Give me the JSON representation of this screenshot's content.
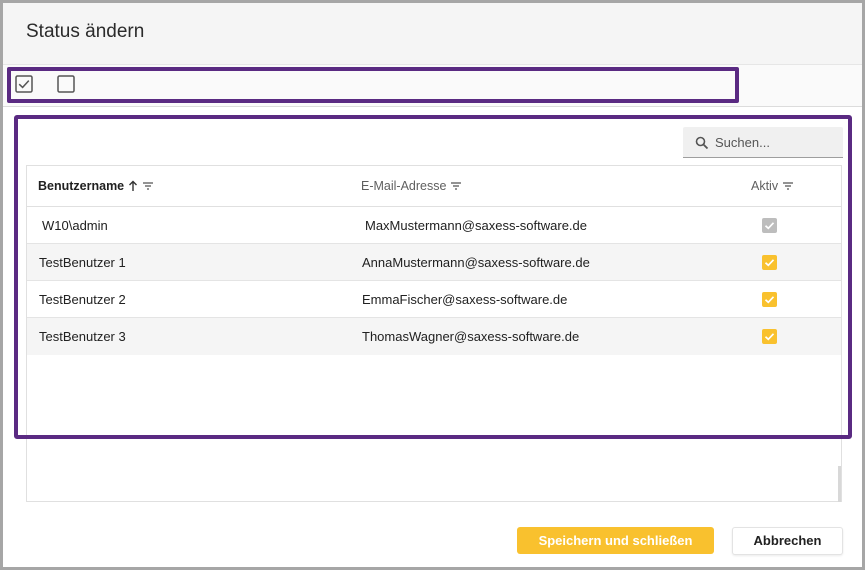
{
  "dialog": {
    "title": "Status ändern"
  },
  "toolbar": {
    "activate_icon": "checked-box-icon",
    "deactivate_icon": "empty-box-icon"
  },
  "search": {
    "placeholder": "Suchen..."
  },
  "grid": {
    "columns": [
      {
        "label": "Benutzername",
        "sort": "ascending",
        "filter_icon": "filter-icon"
      },
      {
        "label": "E-Mail-Adresse",
        "filter_icon": "filter-icon"
      },
      {
        "label": "Aktiv",
        "filter_icon": "filter-icon"
      }
    ],
    "rows": [
      {
        "username": "W10\\admin",
        "email": "MaxMustermann@saxess-software.de",
        "active": true,
        "disabled": true
      },
      {
        "username": "TestBenutzer 1",
        "email": "AnnaMustermann@saxess-software.de",
        "active": true,
        "disabled": false
      },
      {
        "username": "TestBenutzer 2",
        "email": "EmmaFischer@saxess-software.de",
        "active": true,
        "disabled": false
      },
      {
        "username": "TestBenutzer 3",
        "email": "ThomasWagner@saxess-software.de",
        "active": true,
        "disabled": false
      }
    ]
  },
  "footer": {
    "save_label": "Speichern und schließen",
    "cancel_label": "Abbrechen"
  },
  "colors": {
    "accent": "#f9c12e",
    "highlight_border": "#5a2a82",
    "disabled_check": "#bdbdbd"
  }
}
